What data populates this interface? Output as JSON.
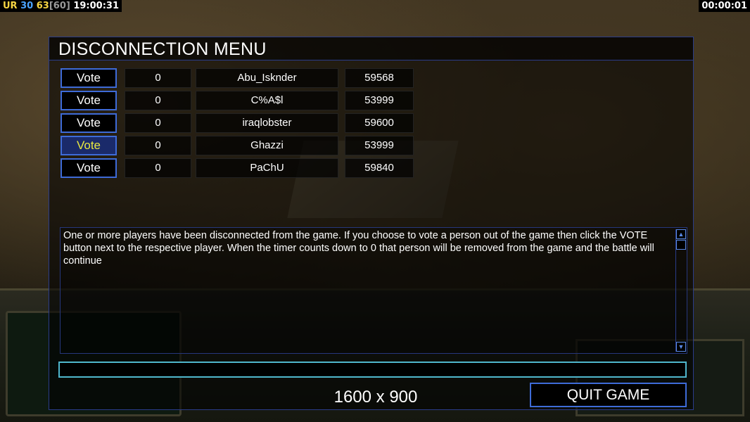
{
  "hud": {
    "tag": "UR",
    "fps": "30",
    "frame": "63",
    "frame_cap": "[60]",
    "clock": "19:00:31",
    "game_timer": "00:00:01"
  },
  "dialog": {
    "title": "DISCONNECTION MENU",
    "players": [
      {
        "vote_label": "Vote",
        "count": "0",
        "name": "Abu_Isknder",
        "ping": "59568"
      },
      {
        "vote_label": "Vote",
        "count": "0",
        "name": "C%A$l",
        "ping": "53999"
      },
      {
        "vote_label": "Vote",
        "count": "0",
        "name": "iraqlobster",
        "ping": "59600"
      },
      {
        "vote_label": "Vote",
        "count": "0",
        "name": "Ghazzi",
        "ping": "53999"
      },
      {
        "vote_label": "Vote",
        "count": "0",
        "name": "PaChU",
        "ping": "59840"
      }
    ],
    "message": "One or more players have been disconnected from the game. If you choose to vote a person out of the game then click the VOTE button next to the respective player. When the timer counts down to 0 that person will be removed from the game and the battle will continue",
    "chat_value": "",
    "resolution": "1600 x 900",
    "quit_label": "QUIT GAME"
  },
  "colors": {
    "accent_border": "#3e6bd8",
    "chat_border": "#4fb6cc",
    "hover_text": "#e8e840"
  },
  "icons": {
    "scroll_up": "scroll-up-arrow-icon",
    "scroll_down": "scroll-down-arrow-icon"
  }
}
